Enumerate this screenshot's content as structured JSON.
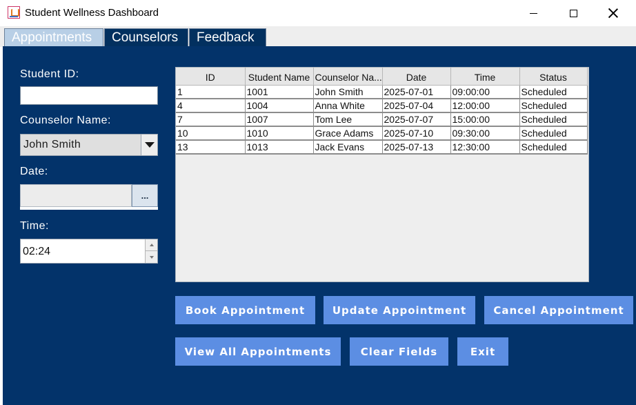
{
  "window": {
    "title": "Student Wellness Dashboard"
  },
  "tabs": [
    {
      "label": "Appointments",
      "selected": true
    },
    {
      "label": "Counselors",
      "selected": false
    },
    {
      "label": "Feedback",
      "selected": false
    }
  ],
  "form": {
    "student_id_label": "Student ID:",
    "student_id_value": "",
    "counselor_label": "Counselor Name:",
    "counselor_selected": "John Smith",
    "date_label": "Date:",
    "date_value": "",
    "date_picker_label": "...",
    "time_label": "Time:",
    "time_value": "02:24"
  },
  "table": {
    "columns": [
      "ID",
      "Student Name",
      "Counselor Na...",
      "Date",
      "Time",
      "Status"
    ],
    "rows": [
      [
        "1",
        "1001",
        "John Smith",
        "2025-07-01",
        "09:00:00",
        "Scheduled"
      ],
      [
        "4",
        "1004",
        "Anna White",
        "2025-07-04",
        "12:00:00",
        "Scheduled"
      ],
      [
        "7",
        "1007",
        "Tom Lee",
        "2025-07-07",
        "15:00:00",
        "Scheduled"
      ],
      [
        "10",
        "1010",
        "Grace Adams",
        "2025-07-10",
        "09:30:00",
        "Scheduled"
      ],
      [
        "13",
        "1013",
        "Jack Evans",
        "2025-07-13",
        "12:30:00",
        "Scheduled"
      ]
    ]
  },
  "buttons": {
    "book": "Book Appointment",
    "update": "Update Appointment",
    "cancel": "Cancel Appointment",
    "view_all": "View All Appointments",
    "clear": "Clear Fields",
    "exit": "Exit"
  },
  "colors": {
    "panel_background": "#03336a",
    "button_background": "#5c8ee3",
    "selected_tab": "#b8cfe6",
    "unselected_tab": "#02305f"
  },
  "icons": {
    "app": "java-cup-icon",
    "minimize": "minimize-icon",
    "maximize": "maximize-icon",
    "close": "close-icon",
    "dropdown": "chevron-down-icon",
    "spin_up": "spin-up-icon",
    "spin_down": "spin-down-icon"
  }
}
